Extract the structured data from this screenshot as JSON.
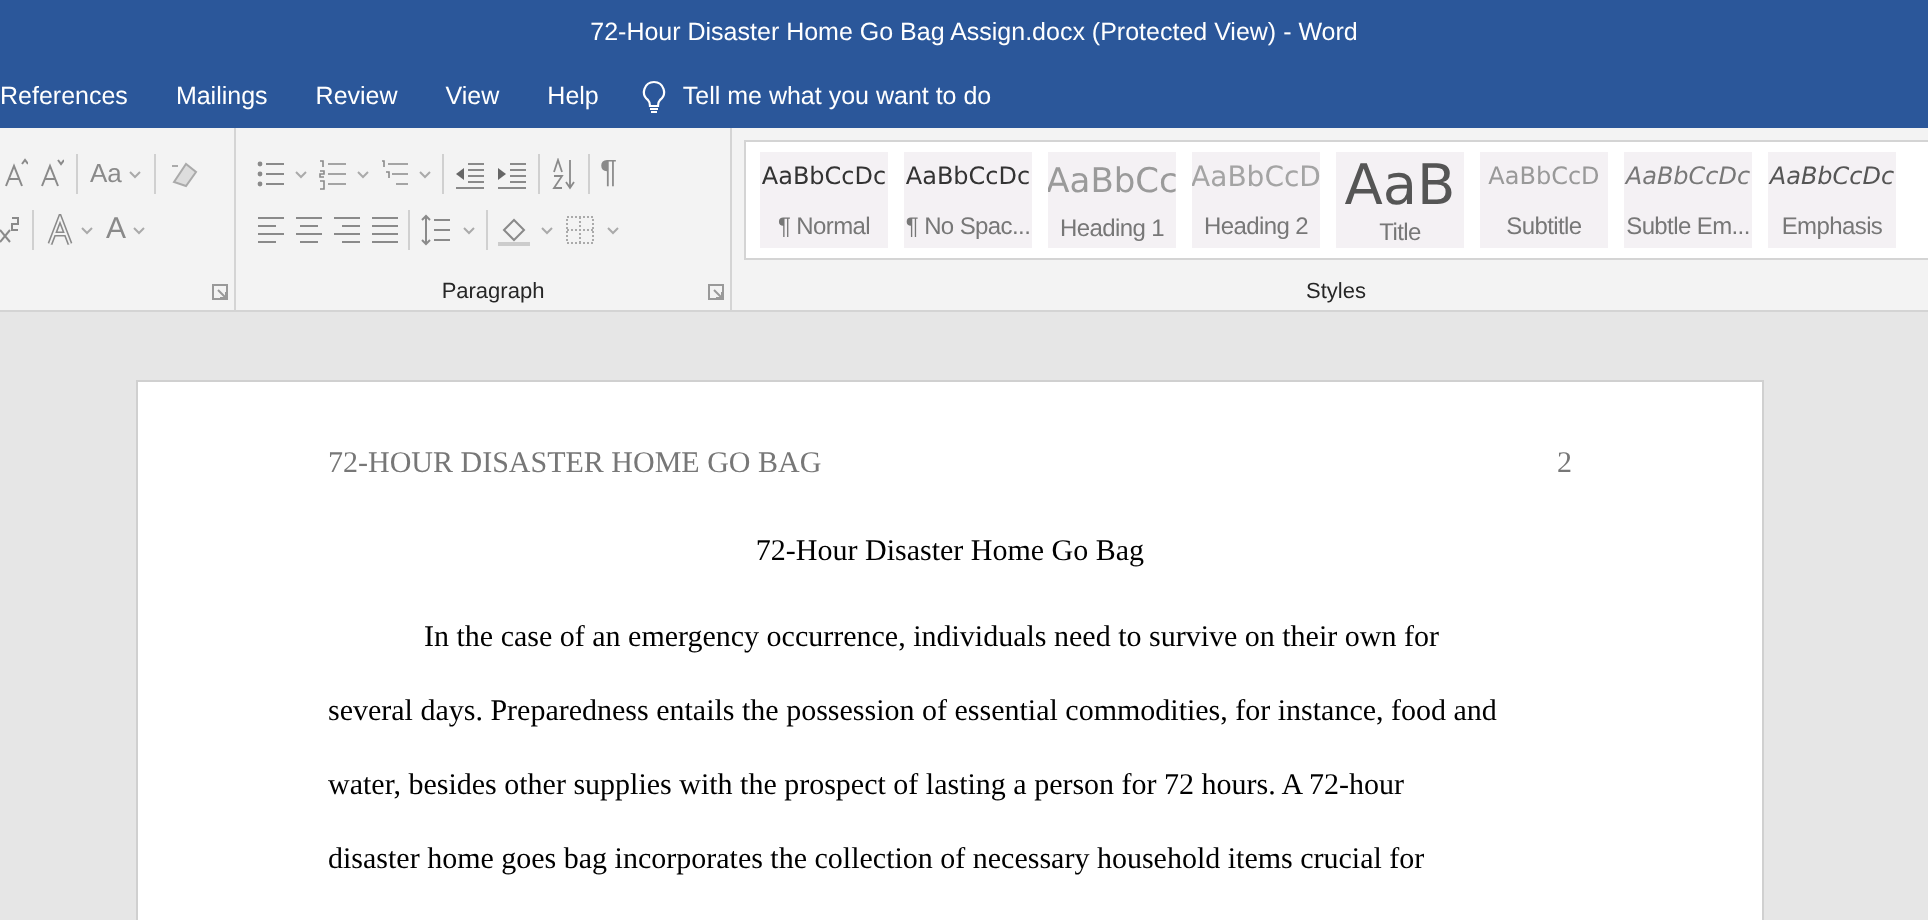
{
  "window": {
    "title": "72-Hour Disaster Home Go Bag Assign.docx (Protected View)  -  Word"
  },
  "ribbon_tabs": [
    {
      "label": "References"
    },
    {
      "label": "Mailings"
    },
    {
      "label": "Review"
    },
    {
      "label": "View"
    },
    {
      "label": "Help"
    }
  ],
  "tell_me": {
    "placeholder": "Tell me what you want to do"
  },
  "font_group": {
    "row_1": [
      {
        "kind": "grow"
      },
      {
        "kind": "shrink"
      },
      {
        "kind": "sep"
      },
      {
        "kind": "case",
        "label": "Aa"
      },
      {
        "kind": "sep"
      },
      {
        "kind": "clear"
      }
    ],
    "row_2": [
      {
        "kind": "superscript"
      },
      {
        "kind": "sep"
      },
      {
        "kind": "effects"
      },
      {
        "kind": "color",
        "label": "A"
      }
    ]
  },
  "paragraph_group": {
    "label": "Paragraph",
    "pilcrow": "¶"
  },
  "styles_group": {
    "label": "Styles",
    "styles": [
      {
        "preview": "AaBbCcDc",
        "name": "¶ Normal",
        "kind": "normal"
      },
      {
        "preview": "AaBbCcDc",
        "name": "¶ No Spac...",
        "kind": "normal"
      },
      {
        "preview": "AaBbCc",
        "name": "Heading 1",
        "kind": "heading1"
      },
      {
        "preview": "AaBbCcD",
        "name": "Heading 2",
        "kind": "heading2"
      },
      {
        "preview": "AaB",
        "name": "Title",
        "kind": "title"
      },
      {
        "preview": "AaBbCcD",
        "name": "Subtitle",
        "kind": "subtitle"
      },
      {
        "preview": "AaBbCcDc",
        "name": "Subtle Em...",
        "kind": "subtle"
      },
      {
        "preview": "AaBbCcDc",
        "name": "Emphasis",
        "kind": "emphasis"
      }
    ]
  },
  "document": {
    "running_head": "72-HOUR DISASTER HOME GO BAG",
    "page_number": "2",
    "title": "72-Hour Disaster Home Go Bag",
    "lines": [
      "In the case of an emergency occurrence, individuals need to survive on their own for",
      "several days. Preparedness entails the possession of essential commodities, for instance, food and",
      "water, besides other supplies with the prospect of lasting a person for 72 hours. A 72-hour",
      "disaster home goes bag incorporates the collection of necessary household items crucial for"
    ]
  }
}
